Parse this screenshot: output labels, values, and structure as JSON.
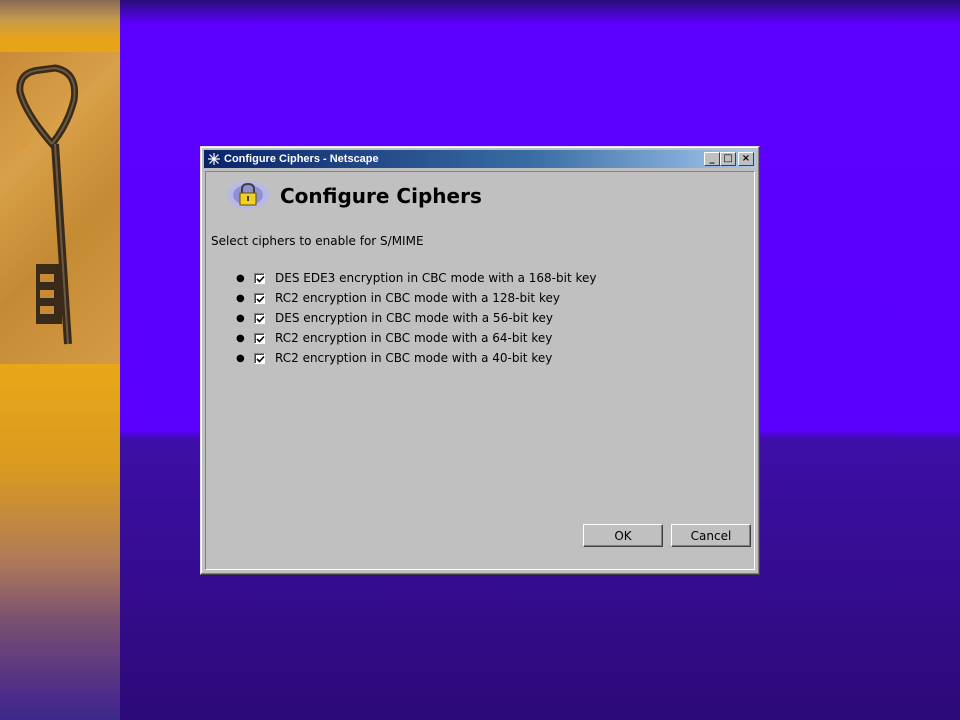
{
  "window": {
    "title": "Configure Ciphers - Netscape",
    "minimize": "_",
    "maximize": "□",
    "close": "×"
  },
  "header": {
    "title": "Configure Ciphers",
    "icon": "lock-icon"
  },
  "subtitle": "Select ciphers to enable for S/MIME",
  "ciphers": [
    {
      "label": "DES EDE3 encryption in CBC mode with a 168-bit key",
      "checked": true
    },
    {
      "label": "RC2 encryption in CBC mode with a 128-bit key",
      "checked": true
    },
    {
      "label": "DES encryption in CBC mode with a 56-bit key",
      "checked": true
    },
    {
      "label": "RC2 encryption in CBC mode with a 64-bit key",
      "checked": true
    },
    {
      "label": "RC2 encryption in CBC mode with a 40-bit key",
      "checked": true
    }
  ],
  "buttons": {
    "ok": "OK",
    "cancel": "Cancel"
  },
  "colors": {
    "background": "#5a00ff",
    "strip": "#e9a818",
    "dialog": "#c0c0c0",
    "titlebar": "#0a246a"
  }
}
